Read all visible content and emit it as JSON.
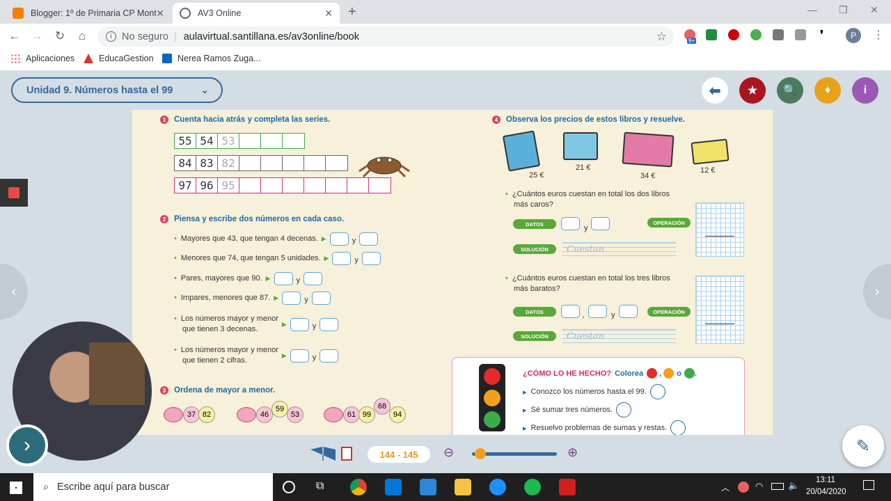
{
  "browser": {
    "tabs": [
      {
        "title": "Blogger: 1º de Primaria CP Mont",
        "active": false
      },
      {
        "title": "AV3 Online",
        "active": true
      }
    ],
    "security": "No seguro",
    "url": "aulavirtual.santillana.es/av3online/book",
    "bookmarks": [
      "Aplicaciones",
      "EducaGestion",
      "Nerea Ramos Zuga..."
    ],
    "ext_badge": "9+",
    "profile_initial": "P"
  },
  "app": {
    "unit_selector": "Unidad 9. Números hasta el 99",
    "page_range": "144 - 145",
    "zoom_level": 0.1
  },
  "page": {
    "ex1": {
      "number": "1",
      "title": "Cuenta hacia atrás y completa las series.",
      "rows": [
        {
          "cells": [
            "55",
            "54",
            "53",
            "",
            "",
            ""
          ],
          "color": "#3cab4a"
        },
        {
          "cells": [
            "84",
            "83",
            "82",
            "",
            "",
            "",
            "",
            ""
          ],
          "color": "#666666"
        },
        {
          "cells": [
            "97",
            "96",
            "95",
            "",
            "",
            "",
            "",
            "",
            "",
            ""
          ],
          "color": "#d62c84"
        }
      ]
    },
    "ex2": {
      "number": "2",
      "title": "Piensa y escribe dos números en cada caso.",
      "items": [
        [
          "Mayores que 43, que tengan 4 decenas."
        ],
        [
          "Menores que 74, que tengan 5 unidades."
        ],
        [
          "Pares, mayores que 90."
        ],
        [
          "Impares, menores que 87."
        ],
        [
          "Los números mayor y menor",
          "que tienen 3 decenas."
        ],
        [
          "Los números mayor y menor",
          "que tienen 2 cifras."
        ]
      ],
      "connector": "y"
    },
    "ex3": {
      "number": "3",
      "title": "Ordena de mayor a menor.",
      "groups": [
        [
          "37",
          "82"
        ],
        [
          "46",
          "59",
          "53"
        ],
        [
          "61",
          "99",
          "68",
          "94"
        ]
      ]
    },
    "ex4": {
      "number": "4",
      "title": "Observa los precios de estos libros y resuelve.",
      "prices": [
        "25 €",
        "21 €",
        "34 €",
        "12 €"
      ],
      "q1": [
        "¿Cuántos euros cuestan en total los dos libros",
        "más caros?"
      ],
      "q2": [
        "¿Cuántos euros cuestan en total los tres libros",
        "más baratos?"
      ],
      "datos": "DATOS",
      "operacion": "OPERACIÓN",
      "solucion": "SOLUCIÓN",
      "cuestan": "Cuestan",
      "comma": ","
    },
    "selfcheck": {
      "title": "¿CÓMO LO HE HECHO?",
      "instruction": "Colorea",
      "or": "o",
      "period": ".",
      "items": [
        "Conozco los números hasta el 99.",
        "Sé sumar tres números.",
        "Resuelvo problemas de sumas y restas."
      ]
    }
  },
  "taskbar": {
    "search_placeholder": "Escribe aquí para buscar",
    "time": "13:11",
    "date": "20/04/2020"
  }
}
